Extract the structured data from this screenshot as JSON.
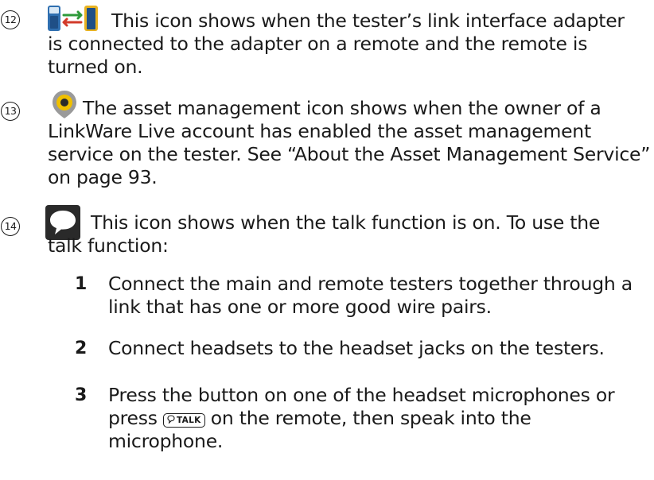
{
  "items": [
    {
      "number": "12",
      "icon": "link-interface-adapter-icon",
      "lines": [
        "This icon shows when the tester’s link interface adapter",
        "is connected to the adapter on a remote and the remote is",
        "turned on."
      ]
    },
    {
      "number": "13",
      "icon": "asset-management-icon",
      "lines": [
        "The asset management icon shows when the owner of a",
        "LinkWare Live account has enabled the asset management",
        "service on the tester. See “About the Asset Management Service”",
        "on page 93."
      ]
    },
    {
      "number": "14",
      "icon": "talk-speech-bubble-icon",
      "lines": [
        "This icon shows when the talk function is on. To use the",
        "talk function:"
      ]
    }
  ],
  "steps": [
    {
      "number": "1",
      "lines": [
        "Connect the main and remote testers together through a",
        "link that has one or more good wire pairs."
      ]
    },
    {
      "number": "2",
      "lines": [
        "Connect headsets to the headset jacks on the testers."
      ]
    },
    {
      "number": "3",
      "line1": "Press the button on one of the headset microphones or",
      "line2_before": "press",
      "talk_key": "TALK",
      "line2_after": "on the remote, then speak into the",
      "line3": "microphone."
    }
  ],
  "colors": {
    "adapter_blue": "#2f6fb0",
    "adapter_yellow": "#e8b220",
    "arrow_green": "#2e9a3a",
    "arrow_red": "#d23a2a",
    "asset_ring_yellow": "#f0c000",
    "icon_dark": "#2a2a2a"
  }
}
